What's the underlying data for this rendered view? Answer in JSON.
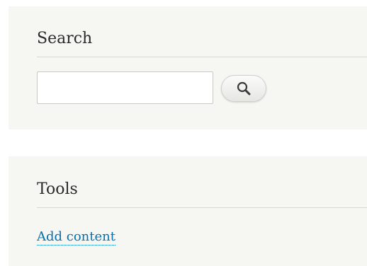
{
  "search_block": {
    "title": "Search",
    "input": {
      "value": "",
      "placeholder": ""
    },
    "button": {
      "icon": "search-icon"
    }
  },
  "tools_block": {
    "title": "Tools",
    "links": [
      {
        "label": "Add content"
      }
    ]
  },
  "colors": {
    "block_background": "#f6f6f2",
    "link": "#0071b3",
    "heading_text": "#2b2b2b"
  }
}
